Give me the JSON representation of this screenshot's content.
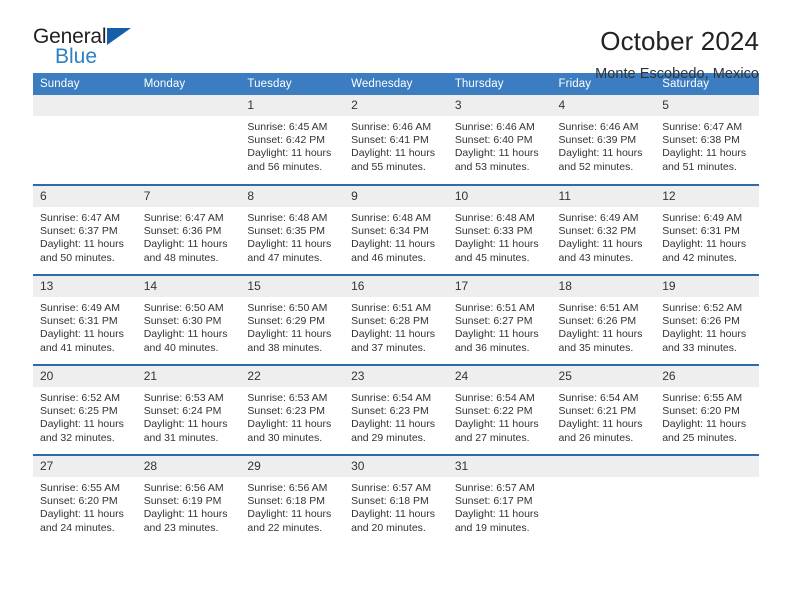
{
  "brand": {
    "name_top": "General",
    "name_bottom": "Blue",
    "accent_color": "#2b80c6",
    "triangle_color": "#1460a8"
  },
  "header": {
    "month_title": "October 2024",
    "location": "Monte Escobedo, Mexico"
  },
  "calendar": {
    "header_bg": "#3b7dc0",
    "row_divider_color": "#2f6ba8",
    "daynum_bg": "#eeeeee",
    "day_names": [
      "Sunday",
      "Monday",
      "Tuesday",
      "Wednesday",
      "Thursday",
      "Friday",
      "Saturday"
    ],
    "labels": {
      "sunrise_prefix": "Sunrise:",
      "sunset_prefix": "Sunset:",
      "daylight_prefix": "Daylight:"
    },
    "weeks": [
      [
        {
          "day": "",
          "empty": true
        },
        {
          "day": "",
          "empty": true
        },
        {
          "day": "1",
          "sunrise": "Sunrise: 6:45 AM",
          "sunset": "Sunset: 6:42 PM",
          "daylight_1": "Daylight: 11 hours",
          "daylight_2": "and 56 minutes."
        },
        {
          "day": "2",
          "sunrise": "Sunrise: 6:46 AM",
          "sunset": "Sunset: 6:41 PM",
          "daylight_1": "Daylight: 11 hours",
          "daylight_2": "and 55 minutes."
        },
        {
          "day": "3",
          "sunrise": "Sunrise: 6:46 AM",
          "sunset": "Sunset: 6:40 PM",
          "daylight_1": "Daylight: 11 hours",
          "daylight_2": "and 53 minutes."
        },
        {
          "day": "4",
          "sunrise": "Sunrise: 6:46 AM",
          "sunset": "Sunset: 6:39 PM",
          "daylight_1": "Daylight: 11 hours",
          "daylight_2": "and 52 minutes."
        },
        {
          "day": "5",
          "sunrise": "Sunrise: 6:47 AM",
          "sunset": "Sunset: 6:38 PM",
          "daylight_1": "Daylight: 11 hours",
          "daylight_2": "and 51 minutes."
        }
      ],
      [
        {
          "day": "6",
          "sunrise": "Sunrise: 6:47 AM",
          "sunset": "Sunset: 6:37 PM",
          "daylight_1": "Daylight: 11 hours",
          "daylight_2": "and 50 minutes."
        },
        {
          "day": "7",
          "sunrise": "Sunrise: 6:47 AM",
          "sunset": "Sunset: 6:36 PM",
          "daylight_1": "Daylight: 11 hours",
          "daylight_2": "and 48 minutes."
        },
        {
          "day": "8",
          "sunrise": "Sunrise: 6:48 AM",
          "sunset": "Sunset: 6:35 PM",
          "daylight_1": "Daylight: 11 hours",
          "daylight_2": "and 47 minutes."
        },
        {
          "day": "9",
          "sunrise": "Sunrise: 6:48 AM",
          "sunset": "Sunset: 6:34 PM",
          "daylight_1": "Daylight: 11 hours",
          "daylight_2": "and 46 minutes."
        },
        {
          "day": "10",
          "sunrise": "Sunrise: 6:48 AM",
          "sunset": "Sunset: 6:33 PM",
          "daylight_1": "Daylight: 11 hours",
          "daylight_2": "and 45 minutes."
        },
        {
          "day": "11",
          "sunrise": "Sunrise: 6:49 AM",
          "sunset": "Sunset: 6:32 PM",
          "daylight_1": "Daylight: 11 hours",
          "daylight_2": "and 43 minutes."
        },
        {
          "day": "12",
          "sunrise": "Sunrise: 6:49 AM",
          "sunset": "Sunset: 6:31 PM",
          "daylight_1": "Daylight: 11 hours",
          "daylight_2": "and 42 minutes."
        }
      ],
      [
        {
          "day": "13",
          "sunrise": "Sunrise: 6:49 AM",
          "sunset": "Sunset: 6:31 PM",
          "daylight_1": "Daylight: 11 hours",
          "daylight_2": "and 41 minutes."
        },
        {
          "day": "14",
          "sunrise": "Sunrise: 6:50 AM",
          "sunset": "Sunset: 6:30 PM",
          "daylight_1": "Daylight: 11 hours",
          "daylight_2": "and 40 minutes."
        },
        {
          "day": "15",
          "sunrise": "Sunrise: 6:50 AM",
          "sunset": "Sunset: 6:29 PM",
          "daylight_1": "Daylight: 11 hours",
          "daylight_2": "and 38 minutes."
        },
        {
          "day": "16",
          "sunrise": "Sunrise: 6:51 AM",
          "sunset": "Sunset: 6:28 PM",
          "daylight_1": "Daylight: 11 hours",
          "daylight_2": "and 37 minutes."
        },
        {
          "day": "17",
          "sunrise": "Sunrise: 6:51 AM",
          "sunset": "Sunset: 6:27 PM",
          "daylight_1": "Daylight: 11 hours",
          "daylight_2": "and 36 minutes."
        },
        {
          "day": "18",
          "sunrise": "Sunrise: 6:51 AM",
          "sunset": "Sunset: 6:26 PM",
          "daylight_1": "Daylight: 11 hours",
          "daylight_2": "and 35 minutes."
        },
        {
          "day": "19",
          "sunrise": "Sunrise: 6:52 AM",
          "sunset": "Sunset: 6:26 PM",
          "daylight_1": "Daylight: 11 hours",
          "daylight_2": "and 33 minutes."
        }
      ],
      [
        {
          "day": "20",
          "sunrise": "Sunrise: 6:52 AM",
          "sunset": "Sunset: 6:25 PM",
          "daylight_1": "Daylight: 11 hours",
          "daylight_2": "and 32 minutes."
        },
        {
          "day": "21",
          "sunrise": "Sunrise: 6:53 AM",
          "sunset": "Sunset: 6:24 PM",
          "daylight_1": "Daylight: 11 hours",
          "daylight_2": "and 31 minutes."
        },
        {
          "day": "22",
          "sunrise": "Sunrise: 6:53 AM",
          "sunset": "Sunset: 6:23 PM",
          "daylight_1": "Daylight: 11 hours",
          "daylight_2": "and 30 minutes."
        },
        {
          "day": "23",
          "sunrise": "Sunrise: 6:54 AM",
          "sunset": "Sunset: 6:23 PM",
          "daylight_1": "Daylight: 11 hours",
          "daylight_2": "and 29 minutes."
        },
        {
          "day": "24",
          "sunrise": "Sunrise: 6:54 AM",
          "sunset": "Sunset: 6:22 PM",
          "daylight_1": "Daylight: 11 hours",
          "daylight_2": "and 27 minutes."
        },
        {
          "day": "25",
          "sunrise": "Sunrise: 6:54 AM",
          "sunset": "Sunset: 6:21 PM",
          "daylight_1": "Daylight: 11 hours",
          "daylight_2": "and 26 minutes."
        },
        {
          "day": "26",
          "sunrise": "Sunrise: 6:55 AM",
          "sunset": "Sunset: 6:20 PM",
          "daylight_1": "Daylight: 11 hours",
          "daylight_2": "and 25 minutes."
        }
      ],
      [
        {
          "day": "27",
          "sunrise": "Sunrise: 6:55 AM",
          "sunset": "Sunset: 6:20 PM",
          "daylight_1": "Daylight: 11 hours",
          "daylight_2": "and 24 minutes."
        },
        {
          "day": "28",
          "sunrise": "Sunrise: 6:56 AM",
          "sunset": "Sunset: 6:19 PM",
          "daylight_1": "Daylight: 11 hours",
          "daylight_2": "and 23 minutes."
        },
        {
          "day": "29",
          "sunrise": "Sunrise: 6:56 AM",
          "sunset": "Sunset: 6:18 PM",
          "daylight_1": "Daylight: 11 hours",
          "daylight_2": "and 22 minutes."
        },
        {
          "day": "30",
          "sunrise": "Sunrise: 6:57 AM",
          "sunset": "Sunset: 6:18 PM",
          "daylight_1": "Daylight: 11 hours",
          "daylight_2": "and 20 minutes."
        },
        {
          "day": "31",
          "sunrise": "Sunrise: 6:57 AM",
          "sunset": "Sunset: 6:17 PM",
          "daylight_1": "Daylight: 11 hours",
          "daylight_2": "and 19 minutes."
        },
        {
          "day": "",
          "empty": true
        },
        {
          "day": "",
          "empty": true
        }
      ]
    ]
  }
}
